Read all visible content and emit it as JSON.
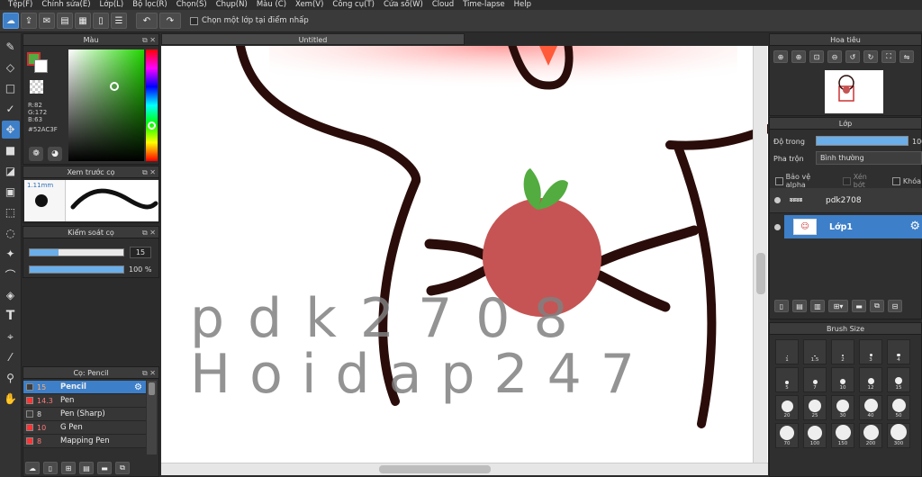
{
  "menu": [
    "Tệp(F)",
    "Chỉnh sửa(E)",
    "Lớp(L)",
    "Bộ lọc(R)",
    "Chọn(S)",
    "Chụp(N)",
    "Màu (C)",
    "Xem(V)",
    "Công cụ(T)",
    "Cửa sổ(W)",
    "Cloud",
    "Time-lapse",
    "Help"
  ],
  "toolbar": {
    "select_at_click_label": "Chọn một lớp tại điểm nhấp"
  },
  "color_panel": {
    "title": "Màu",
    "r": "R:82",
    "g": "G:172",
    "b": "B:63",
    "hex": "#52AC3F",
    "fg_color": "#52AC3F"
  },
  "preview_panel": {
    "title": "Xem trước cọ",
    "size": "1.11mm"
  },
  "brush_control": {
    "title": "Kiểm soát cọ",
    "size_value": "15",
    "size_fraction": 0.31,
    "opacity_value": "100 %",
    "opacity_fraction": 1.0
  },
  "brush_list": {
    "title": "Cọ: Pencil",
    "items": [
      {
        "size": "15",
        "name": "Pencil",
        "color": "#3d3d3d",
        "selected": true
      },
      {
        "size": "14.3",
        "name": "Pen",
        "color": "#ff3333",
        "selected": false
      },
      {
        "size": "8",
        "name": "Pen (Sharp)",
        "color": "#3d3d3d",
        "selected": false
      },
      {
        "size": "10",
        "name": "G Pen",
        "color": "#ff3333",
        "selected": false
      },
      {
        "size": "8",
        "name": "Mapping Pen",
        "color": "#ff3333",
        "selected": false
      }
    ]
  },
  "canvas": {
    "tab_title": "Untitled"
  },
  "watermark": {
    "line1": "pdk2708",
    "line2": "Hoidap247"
  },
  "navigator": {
    "title": "Hoa tiêu"
  },
  "layer_panel": {
    "title": "Lớp",
    "opacity_label": "Độ trong",
    "opacity_value": "100",
    "blend_label": "Pha trộn",
    "blend_value": "Bình thường",
    "protect_alpha": "Bảo vệ alpha",
    "clipping": "Xén bớt",
    "lock": "Khóa",
    "layers": [
      {
        "name": "pdk2708",
        "selected": false
      },
      {
        "name": "Lớp1",
        "selected": true
      }
    ]
  },
  "brush_size": {
    "title": "Brush Size",
    "sizes": [
      "1",
      "1.5",
      "2",
      "3",
      "4",
      "5",
      "7",
      "10",
      "12",
      "15",
      "20",
      "25",
      "30",
      "40",
      "50",
      "70",
      "100",
      "150",
      "200",
      "300"
    ]
  },
  "colors": {
    "accent": "#3d7fc8",
    "stroke": "#2a0d0a",
    "tomato": "#c65454",
    "leaf": "#52AC3F"
  }
}
